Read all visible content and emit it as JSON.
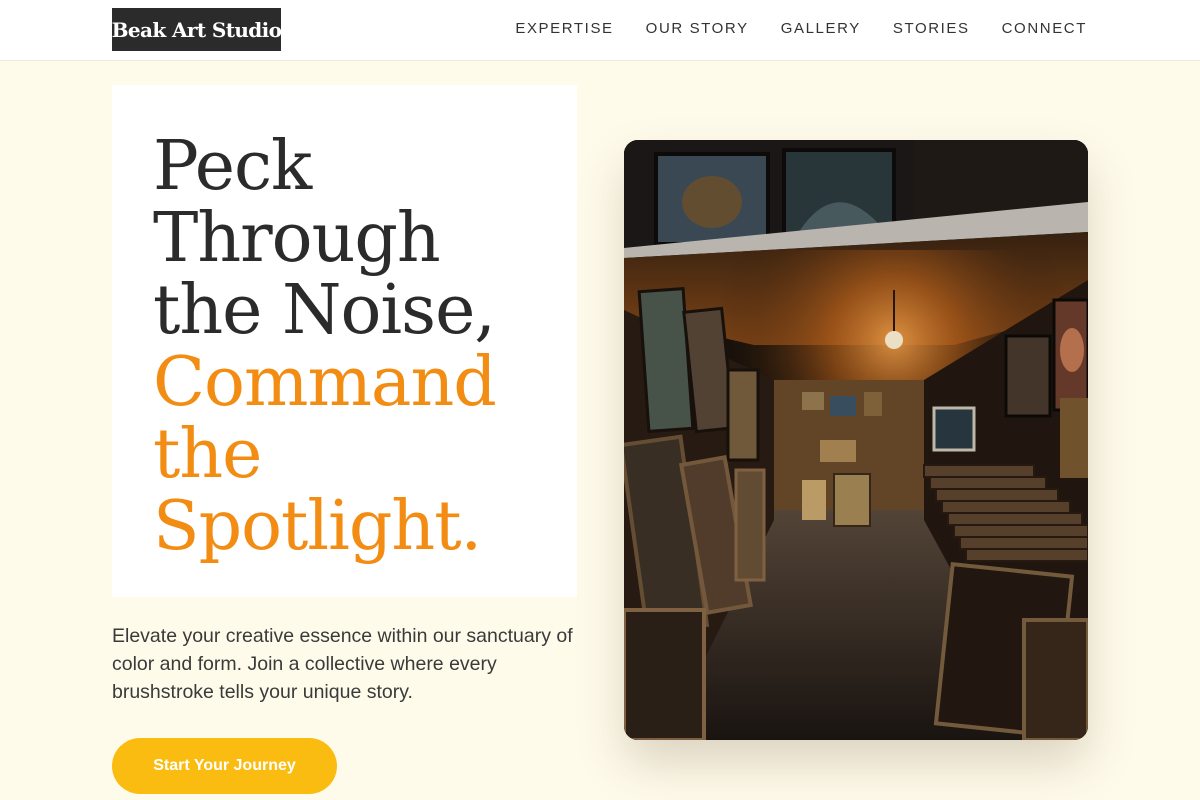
{
  "brand": {
    "name": "Beak Art Studio"
  },
  "nav": {
    "items": [
      {
        "label": "EXPERTISE"
      },
      {
        "label": "OUR STORY"
      },
      {
        "label": "GALLERY"
      },
      {
        "label": "STORIES"
      },
      {
        "label": "CONNECT"
      }
    ]
  },
  "hero": {
    "headline_lines": [
      "Peck",
      "Through",
      "the Noise,"
    ],
    "accent_lines": [
      "Command",
      "the",
      "Spotlight."
    ],
    "description": "Elevate your creative essence within our sanctuary of color and form. Join a collective where every brushstroke tells your unique story.",
    "cta_label": "Start Your Journey"
  },
  "image": {
    "subject": "art-gallery-corridor-photo"
  },
  "colors": {
    "page_background": "#fffbeb",
    "accent": "#f28c12",
    "cta": "#fbbc11",
    "logo_background": "#2b2b2b"
  }
}
